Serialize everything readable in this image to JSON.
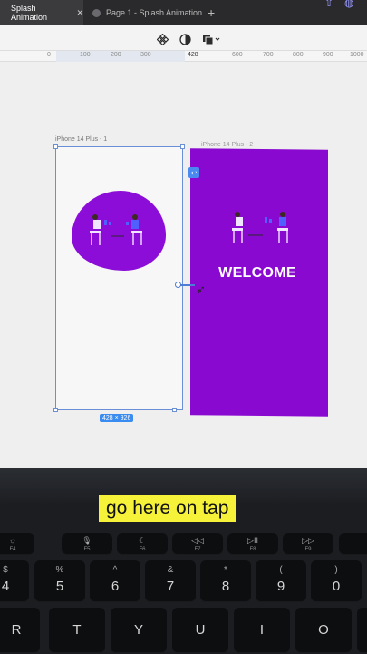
{
  "tabs": {
    "active_label": "Splash Animation",
    "inactive_label": "Page 1 - Splash Animation",
    "add": "+"
  },
  "ruler": [
    "0",
    "100",
    "200",
    "300",
    "428",
    "600",
    "700",
    "800",
    "900",
    "1000"
  ],
  "frames": {
    "frame1_label": "iPhone 14 Plus - 1",
    "frame2_label": "iPhone 14 Plus - 2",
    "size_badge": "428 × 926",
    "welcome": "WELCOME"
  },
  "caption": "go here on tap",
  "keys": {
    "fn_row": [
      {
        "icon": "☼",
        "fn": "F4"
      },
      {
        "icon": "🎙",
        "fn": "F5"
      },
      {
        "icon": "☾",
        "fn": "F6"
      },
      {
        "icon": "◁◁",
        "fn": "F7"
      },
      {
        "icon": "▷II",
        "fn": "F8"
      },
      {
        "icon": "▷▷",
        "fn": "F9"
      }
    ],
    "num_row": [
      {
        "top": "$",
        "main": "4"
      },
      {
        "top": "%",
        "main": "5"
      },
      {
        "top": "^",
        "main": "6"
      },
      {
        "top": "&",
        "main": "7"
      },
      {
        "top": "*",
        "main": "8"
      },
      {
        "top": "(",
        "main": "9"
      },
      {
        "top": ")",
        "main": "0"
      }
    ],
    "letter_row": [
      "R",
      "T",
      "Y",
      "U",
      "I",
      "O"
    ]
  },
  "colors": {
    "accent_purple": "#8a09d0",
    "selection_blue": "#3b8cf0",
    "caption_bg": "#f6f23a"
  }
}
